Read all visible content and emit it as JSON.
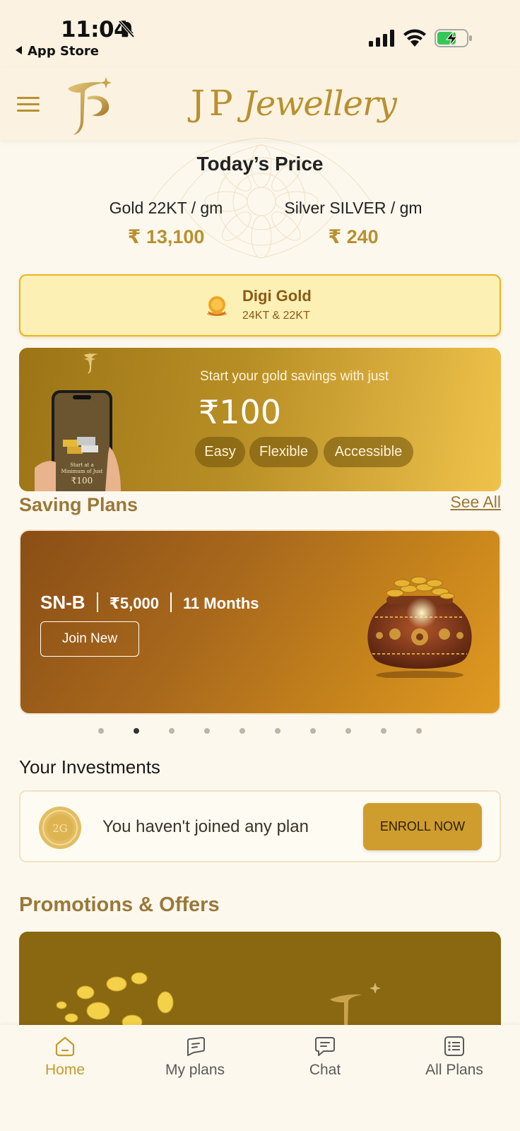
{
  "status_bar": {
    "time": "11:04",
    "back_label": "App Store"
  },
  "header": {
    "brand_initials": "JP",
    "brand_word": "Jewellery"
  },
  "prices": {
    "title": "Today’s Price",
    "gold_label": "Gold 22KT / gm",
    "gold_value": "₹ 13,100",
    "silver_label": "Silver SILVER / gm",
    "silver_value": "₹ 240"
  },
  "digi_gold": {
    "title": "Digi Gold",
    "subtitle": "24KT & 22KT"
  },
  "savings_banner": {
    "tagline": "Start your gold savings with just",
    "amount": "₹100",
    "pills": [
      "Easy",
      "Flexible",
      "Accessible"
    ],
    "phone_text_1": "Start at a",
    "phone_text_2": "Minimum of Just",
    "phone_amount": "₹100"
  },
  "saving_plans": {
    "title": "Saving Plans",
    "see_all": "See All",
    "current": {
      "code": "SN-B",
      "amount": "₹5,000",
      "duration": "11 Months",
      "join_label": "Join New"
    },
    "carousel_count": 10,
    "carousel_active": 2
  },
  "investments": {
    "title": "Your Investments",
    "coin_label": "2G",
    "empty_text": "You haven't joined any plan",
    "enroll_label": "ENROLL NOW"
  },
  "promotions": {
    "title": "Promotions & Offers"
  },
  "tabbar": {
    "items": [
      {
        "label": "Home",
        "icon": "home-icon",
        "active": true
      },
      {
        "label": "My plans",
        "icon": "plans-icon",
        "active": false
      },
      {
        "label": "Chat",
        "icon": "chat-icon",
        "active": false
      },
      {
        "label": "All Plans",
        "icon": "list-icon",
        "active": false
      }
    ]
  },
  "colors": {
    "accent": "#b8902e",
    "background": "#fdf8ee",
    "digi_border": "#e8b422",
    "enroll_button": "#cf9d2e"
  }
}
